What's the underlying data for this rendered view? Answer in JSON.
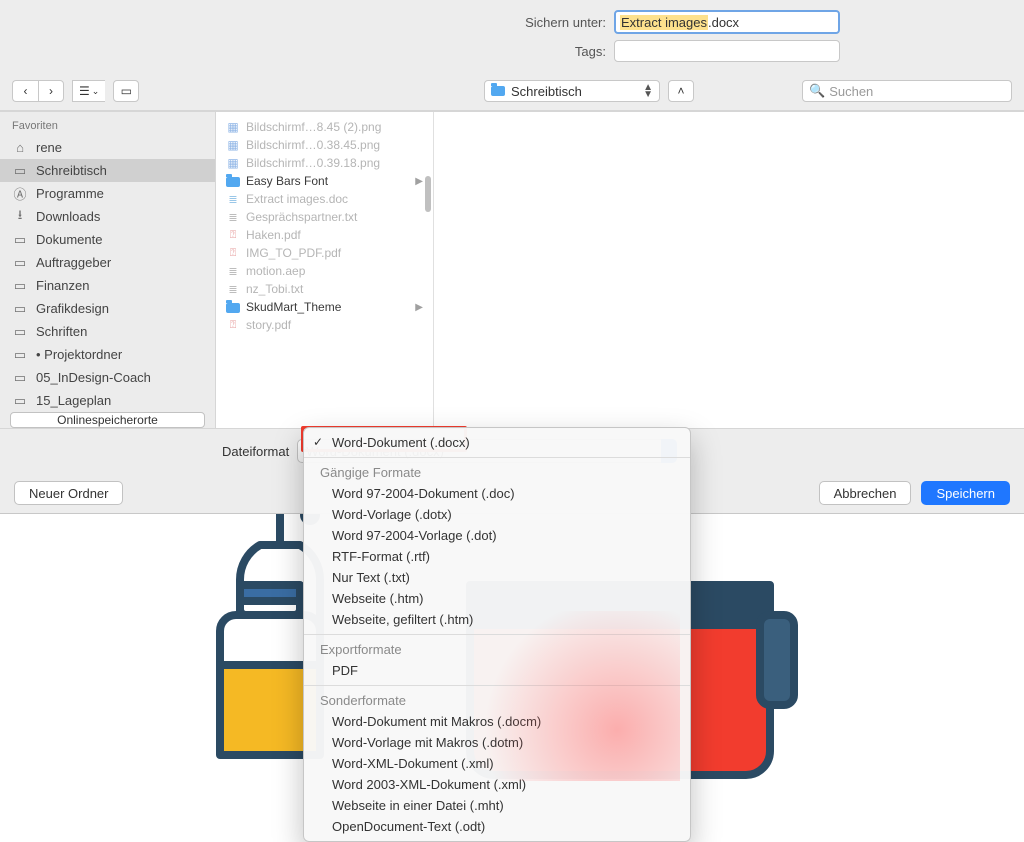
{
  "labels": {
    "saveAs": "Sichern unter:",
    "tags": "Tags:",
    "fileFormat": "Dateiformat",
    "onlineLocations": "Onlinespeicherorte",
    "newFolder": "Neuer Ordner",
    "cancel": "Abbrechen",
    "save": "Speichern",
    "searchPlaceholder": "Suchen",
    "favorites": "Favoriten"
  },
  "filename": {
    "selected": "Extract images",
    "ext": ".docx"
  },
  "location": "Schreibtisch",
  "sidebar": [
    {
      "label": "rene",
      "icon": "home"
    },
    {
      "label": "Schreibtisch",
      "icon": "desktop",
      "selected": true
    },
    {
      "label": "Programme",
      "icon": "apps"
    },
    {
      "label": "Downloads",
      "icon": "downloads"
    },
    {
      "label": "Dokumente",
      "icon": "folder"
    },
    {
      "label": "Auftraggeber",
      "icon": "folder"
    },
    {
      "label": "Finanzen",
      "icon": "folder"
    },
    {
      "label": "Grafikdesign",
      "icon": "folder"
    },
    {
      "label": "Schriften",
      "icon": "folder"
    },
    {
      "label": "• Projektordner",
      "icon": "folder"
    },
    {
      "label": "05_InDesign-Coach",
      "icon": "folder"
    },
    {
      "label": "15_Lageplan",
      "icon": "folder"
    }
  ],
  "files": [
    {
      "label": "Bildschirmf…8.45 (2).png",
      "type": "img",
      "dim": true
    },
    {
      "label": "Bildschirmf…0.38.45.png",
      "type": "img",
      "dim": true
    },
    {
      "label": "Bildschirmf…0.39.18.png",
      "type": "img",
      "dim": true
    },
    {
      "label": "Easy Bars Font",
      "type": "folder",
      "chevron": true
    },
    {
      "label": "Extract images.doc",
      "type": "doc",
      "dim": true
    },
    {
      "label": "Gesprächspartner.txt",
      "type": "txt",
      "dim": true
    },
    {
      "label": "Haken.pdf",
      "type": "pdf",
      "dim": true
    },
    {
      "label": "IMG_TO_PDF.pdf",
      "type": "pdf",
      "dim": true
    },
    {
      "label": "motion.aep",
      "type": "txt",
      "dim": true
    },
    {
      "label": "nz_Tobi.txt",
      "type": "txt",
      "dim": true
    },
    {
      "label": "SkudMart_Theme",
      "type": "folder",
      "chevron": true
    },
    {
      "label": "story.pdf",
      "type": "pdf",
      "dim": true
    }
  ],
  "formatSelected": "Word-Dokument (.docx)",
  "menu": {
    "top": "Word-Dokument (.docx)",
    "groups": [
      {
        "title": "Gängige Formate",
        "items": [
          "Word 97-2004-Dokument (.doc)",
          "Word-Vorlage (.dotx)",
          "Word 97-2004-Vorlage (.dot)",
          "RTF-Format (.rtf)",
          "Nur Text (.txt)",
          "Webseite (.htm)",
          "Webseite, gefiltert (.htm)"
        ]
      },
      {
        "title": "Exportformate",
        "items": [
          "PDF"
        ]
      },
      {
        "title": "Sonderformate",
        "items": [
          "Word-Dokument mit Makros (.docm)",
          "Word-Vorlage mit Makros (.dotm)",
          "Word-XML-Dokument (.xml)",
          "Word 2003-XML-Dokument (.xml)",
          "Webseite in einer Datei (.mht)",
          "OpenDocument-Text (.odt)"
        ]
      }
    ]
  }
}
